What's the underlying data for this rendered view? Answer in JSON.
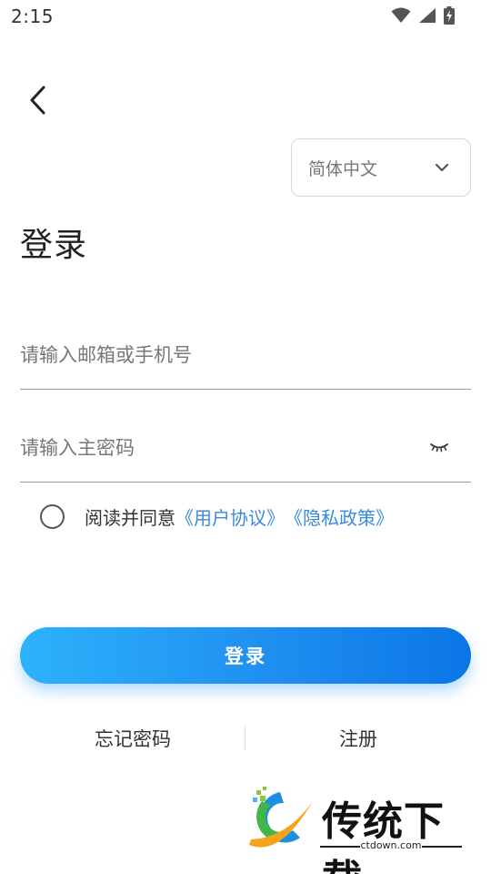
{
  "status_bar": {
    "time": "2:15",
    "icons": [
      "wifi-icon",
      "signal-icon",
      "battery-charging-icon"
    ]
  },
  "header": {
    "back_icon": "chevron-left-icon"
  },
  "language": {
    "selected": "简体中文",
    "icon": "chevron-down-icon"
  },
  "title": "登录",
  "form": {
    "email_placeholder": "请输入邮箱或手机号",
    "password_placeholder": "请输入主密码",
    "password_toggle_icon": "eye-closed-icon"
  },
  "agreement": {
    "prefix": "阅读并同意",
    "user_agreement": "《用户协议》",
    "privacy_policy": "《隐私政策》"
  },
  "login_button": "登录",
  "links": {
    "forgot": "忘记密码",
    "register": "注册"
  },
  "watermark": {
    "brand": "传统下载",
    "url": "ctdown.com"
  },
  "colors": {
    "accent": "#1f8ff0",
    "link": "#3a8bdc",
    "gradient_start": "#2db2fb",
    "gradient_end": "#0a76e6"
  }
}
